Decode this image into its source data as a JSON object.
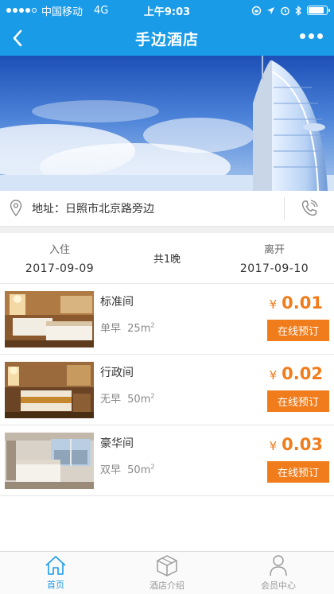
{
  "status": {
    "carrier": "中国移动",
    "network": "4G",
    "time": "上午9:03"
  },
  "nav": {
    "title": "手边酒店"
  },
  "banner": {
    "slide_count": 2,
    "active_slide": 2
  },
  "address": {
    "text": "地址：日照市北京路旁边"
  },
  "stay": {
    "checkin_label": "入住",
    "checkin_date": "2017-09-09",
    "nights": "共1晚",
    "checkout_label": "离开",
    "checkout_date": "2017-09-10"
  },
  "rooms": [
    {
      "name": "标准间",
      "breakfast": "单早",
      "area": "25m",
      "area_unit_sup": "2",
      "currency": "¥",
      "price": "0.01",
      "book_label": "在线预订"
    },
    {
      "name": "行政间",
      "breakfast": "无早",
      "area": "50m",
      "area_unit_sup": "2",
      "currency": "¥",
      "price": "0.02",
      "book_label": "在线预订"
    },
    {
      "name": "豪华间",
      "breakfast": "双早",
      "area": "50m",
      "area_unit_sup": "2",
      "currency": "¥",
      "price": "0.03",
      "book_label": "在线预订"
    }
  ],
  "tabs": [
    {
      "label": "首页",
      "icon": "home-icon",
      "active": true
    },
    {
      "label": "酒店介绍",
      "icon": "cube-icon",
      "active": false
    },
    {
      "label": "会员中心",
      "icon": "user-icon",
      "active": false
    }
  ],
  "colors": {
    "primary": "#1a9be8",
    "accent": "#f07c1b",
    "tab_inactive": "#9a9a9a"
  }
}
